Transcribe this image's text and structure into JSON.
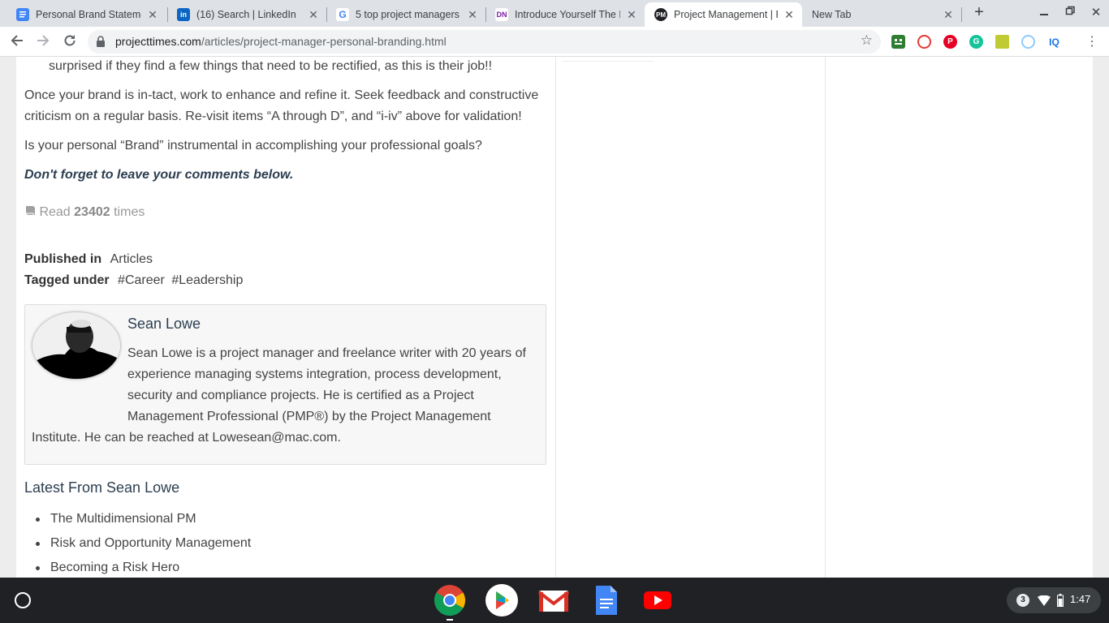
{
  "tabs": [
    {
      "title": "Personal Brand Stateme",
      "icon": "google-docs-icon",
      "active": false
    },
    {
      "title": "(16) Search | LinkedIn",
      "icon": "linkedin-icon",
      "active": false
    },
    {
      "title": "5 top project managers",
      "icon": "google-icon",
      "active": false
    },
    {
      "title": "Introduce Yourself The E",
      "icon": "dn-icon",
      "active": false
    },
    {
      "title": "Project Management | P",
      "icon": "pm-icon",
      "active": true
    },
    {
      "title": "New Tab",
      "icon": "",
      "active": false
    }
  ],
  "tab_icons_text": {
    "pm": "PM",
    "dn": "DN",
    "linkedin": "in",
    "google": "G"
  },
  "toolbar": {
    "url_domain": "projecttimes.com",
    "url_path": "/articles/project-manager-personal-branding.html",
    "extensions": [
      "taskade-icon",
      "lastpass-icon",
      "pinterest-icon",
      "grammarly-icon",
      "notes-icon",
      "extension-icon",
      "iq-icon"
    ],
    "ext_iq_label": "IQ"
  },
  "article": {
    "list_tail": "surprised if they find a few things that need to be rectified, as this is their job!!",
    "para_refine": "Once your brand is in-tact, work to enhance and refine it. Seek feedback and constructive criticism on a regular basis. Re-visit items “A through D”, and “i-iv” above for validation!",
    "para_question": "Is your personal “Brand” instrumental in accomplishing your professional goals?",
    "cta": "Don't forget to leave your comments below.",
    "read_prefix": "Read",
    "read_count": "23402",
    "read_suffix": "times",
    "published_label": "Published in",
    "published_value": "Articles",
    "tagged_label": "Tagged under",
    "tags": [
      "#Career",
      "#Leadership"
    ]
  },
  "author": {
    "name": "Sean Lowe",
    "bio": "Sean Lowe is a project manager and freelance writer with 20 years of experience managing systems integration, process development, security and compliance projects. He is certified as a Project Management Professional (PMP®) by the Project Management Institute. He can be reached at Lowesean@mac.com."
  },
  "latest": {
    "title": "Latest From Sean Lowe",
    "items": [
      "The Multidimensional PM",
      "Risk and Opportunity Management",
      "Becoming a Risk Hero"
    ]
  },
  "shelf": {
    "apps": [
      "chrome-icon",
      "play-store-icon",
      "gmail-icon",
      "google-docs-icon",
      "youtube-icon"
    ],
    "notification_count": "3",
    "time": "1:47"
  }
}
